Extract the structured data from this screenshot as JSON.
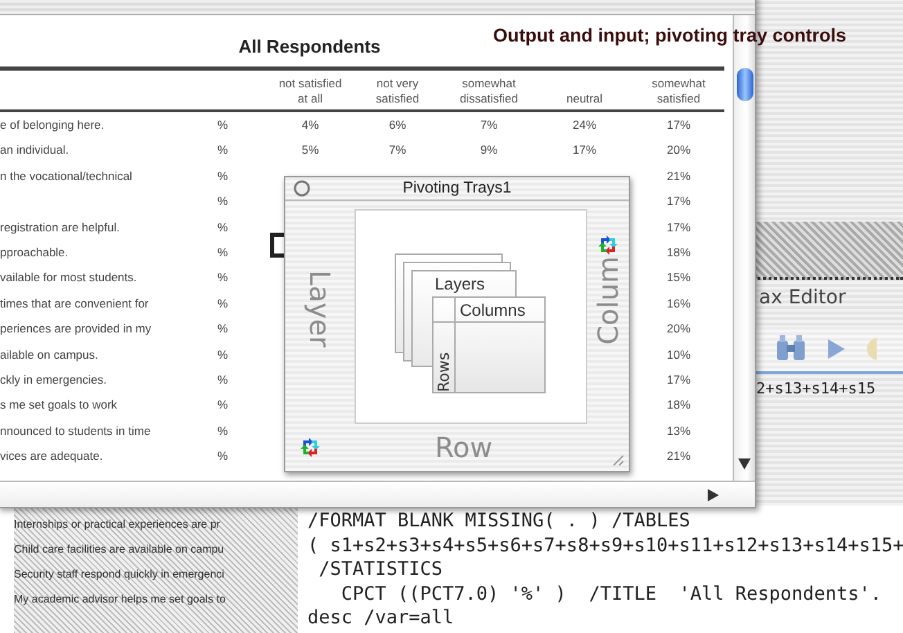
{
  "caption": "Output and input; pivoting tray controls",
  "output_window": {
    "table": {
      "title": "All Respondents",
      "columns": [
        "not satisfied at all",
        "not very satisfied",
        "somewhat dissatisfied",
        "neutral",
        "somewhat satisfied"
      ],
      "rows": [
        {
          "label": "e of belonging here.",
          "unit": "%",
          "values": [
            "4%",
            "6%",
            "7%",
            "24%",
            "17%"
          ]
        },
        {
          "label": "an individual.",
          "unit": "%",
          "values": [
            "5%",
            "7%",
            "9%",
            "17%",
            "20%"
          ]
        },
        {
          "label": "n the vocational/technical",
          "unit": "%",
          "values": [
            "21%"
          ]
        },
        {
          "unit": "%",
          "values": [
            "17%"
          ]
        },
        {
          "label": "registration are helpful.",
          "unit": "%",
          "values": [
            "17%"
          ]
        },
        {
          "label": "pproachable.",
          "unit": "%",
          "values": [
            "18%"
          ]
        },
        {
          "label": "vailable for most students.",
          "unit": "%",
          "values": [
            "15%"
          ]
        },
        {
          "label": "times that are convenient for",
          "unit": "%",
          "values": [
            "16%"
          ]
        },
        {
          "label": "periences are provided in my",
          "unit": "%",
          "values": [
            "20%"
          ]
        },
        {
          "label": "ailable on campus.",
          "unit": "%",
          "values": [
            "10%"
          ]
        },
        {
          "label": "ckly in emergencies.",
          "unit": "%",
          "values": [
            "17%"
          ]
        },
        {
          "label": "s me set goals to work",
          "unit": "%",
          "values": [
            "18%"
          ]
        },
        {
          "label": "nnounced to students in time",
          "unit": "%",
          "values": [
            "13%"
          ]
        },
        {
          "label": "vices are adequate.",
          "unit": "%",
          "values": [
            "21%"
          ]
        }
      ]
    }
  },
  "pivot_trays": {
    "title": "Pivoting Trays1",
    "layer_tray": "Layer",
    "column_tray": "Colum",
    "row_tray": "Row",
    "diagram": {
      "layers": "Layers",
      "columns": "Columns",
      "rows": "Rows"
    }
  },
  "syntax_editor": {
    "title": "ax Editor",
    "visible_text": "2+s13+s14+s15"
  },
  "data_editor": {
    "rows": [
      "Internships or practical experiences are pr",
      "Child care facilities are available on campu",
      "Security staff respond quickly in emergenci",
      "My academic advisor helps me set goals to"
    ]
  },
  "syntax_text": [
    "/FORMAT BLANK MISSING( . ) /TABLES",
    "( s1+s2+s3+s4+s5+s6+s7+s8+s9+s10+s11+s12+s13+s14+s15+",
    " /STATISTICS",
    "   CPCT ((PCT7.0) '%' )  /TITLE  'All Respondents'.",
    "desc /var=all"
  ]
}
